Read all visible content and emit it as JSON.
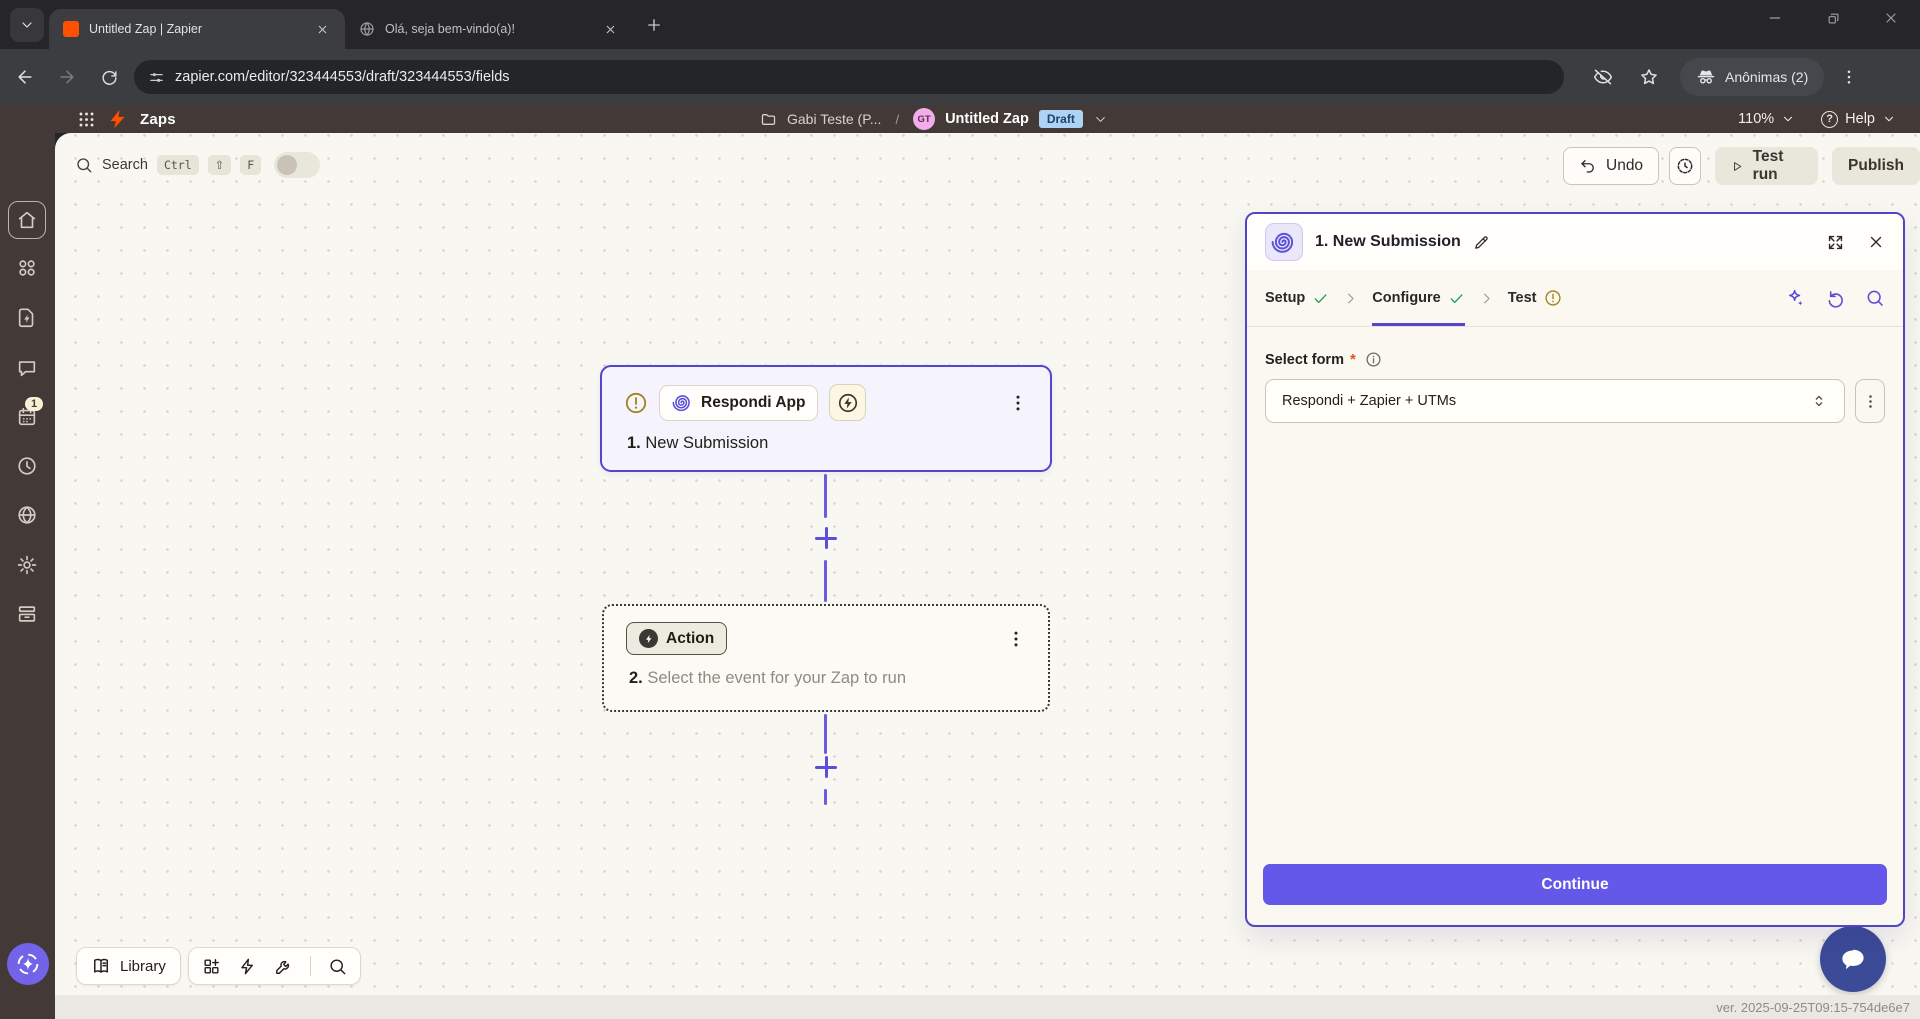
{
  "browser": {
    "tabs": [
      {
        "title": "Untitled Zap | Zapier"
      },
      {
        "title": "Olá, seja bem-vindo(a)!"
      }
    ],
    "url": "zapier.com/editor/323444553/draft/323444553/fields",
    "profile_label": "Anônimas (2)"
  },
  "nav": {
    "product_label": "Zaps",
    "workspace": "Gabi Teste (P...",
    "breadcrumb_separator": "/",
    "avatar_initials": "GT",
    "zap_title": "Untitled Zap",
    "status_badge": "Draft",
    "zoom_level": "110%",
    "help_label": "Help"
  },
  "toolbar": {
    "search_label": "Search",
    "keys": [
      "Ctrl",
      "⇧",
      "F"
    ],
    "undo_label": "Undo",
    "test_run_label": "Test run",
    "publish_label": "Publish"
  },
  "steps": [
    {
      "number": "1.",
      "app_pill": "Respondi App",
      "title": "New Submission"
    },
    {
      "number": "2.",
      "app_pill": "Action",
      "title": "Select the event for your Zap to run"
    }
  ],
  "panel": {
    "step_title": "1. New Submission",
    "tabs": [
      {
        "label": "Setup"
      },
      {
        "label": "Configure"
      },
      {
        "label": "Test"
      }
    ],
    "field_label": "Select form",
    "required_mark": "*",
    "field_value": "Respondi + Zapier + UTMs",
    "continue_label": "Continue"
  },
  "canvas_footer": {
    "library_label": "Library"
  },
  "sidebar": {
    "badge_count": "1"
  },
  "page_footer": {
    "version": "ver. 2025-09-25T09:15-754de6e7"
  },
  "colors": {
    "zapier_orange": "#ff4f00",
    "indigo_accent": "#5548c8",
    "continue_button": "#6358e8",
    "draft_badge_bg": "#add3f4",
    "warning_amber": "#a1811c",
    "success_green": "#1a9e4b",
    "sidebar_brown": "#433936"
  }
}
